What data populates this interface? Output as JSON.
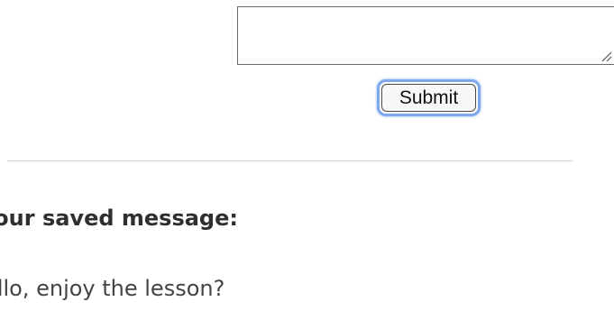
{
  "form": {
    "message_value": "",
    "submit_label": "Submit"
  },
  "saved": {
    "heading": "Your saved message:",
    "message": "Hello, enjoy the lesson?"
  },
  "colors": {
    "focus_ring": "#7ea8ec",
    "divider": "#cfcfcf",
    "heading_text": "#2f2f2f",
    "body_text": "#444444"
  },
  "icons": {
    "textarea_resize": "resize-grip-icon"
  }
}
